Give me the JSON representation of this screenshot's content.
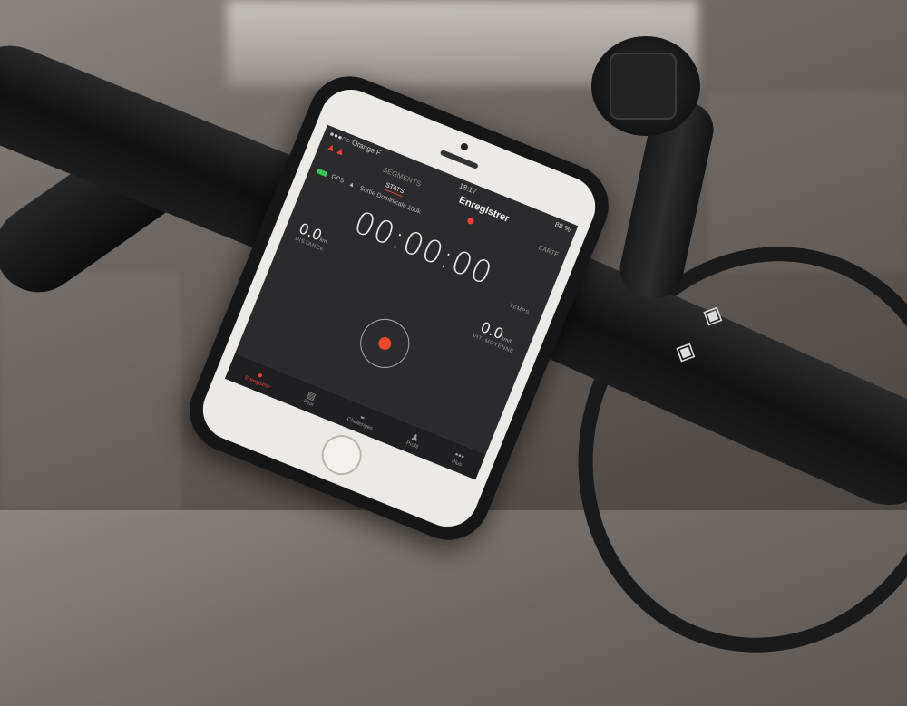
{
  "status_bar": {
    "carrier": "●●●○○ Orange F",
    "time": "18:17",
    "battery": "88 %"
  },
  "nav": {
    "left": "SEGMENTS",
    "title": "Enregistrer"
  },
  "tabs": {
    "stats": "STATS",
    "carte": "CARTE"
  },
  "gps": {
    "label": "GPS",
    "route": "Sortie Dominicale 100k"
  },
  "timer": {
    "value": "00:00:00",
    "label": "TEMPS"
  },
  "distance": {
    "value": "0.0",
    "unit": "km",
    "label": "DISTANCE"
  },
  "speed": {
    "value": "0.0",
    "unit": "km/h",
    "label": "VIT. MOYENNE"
  },
  "tabbar": [
    {
      "icon": "record-icon",
      "glyph": "●",
      "label": "Enregistrer"
    },
    {
      "icon": "feed-icon",
      "glyph": "▤",
      "label": "Flux"
    },
    {
      "icon": "challenge-icon",
      "glyph": "◒",
      "label": "Challenges"
    },
    {
      "icon": "profile-icon",
      "glyph": "♟",
      "label": "Profil"
    },
    {
      "icon": "more-icon",
      "glyph": "•••",
      "label": "Plus"
    }
  ],
  "colors": {
    "accent": "#e8432f",
    "gps_green": "#3ed05b",
    "screen_bg": "#2b2b2d"
  }
}
